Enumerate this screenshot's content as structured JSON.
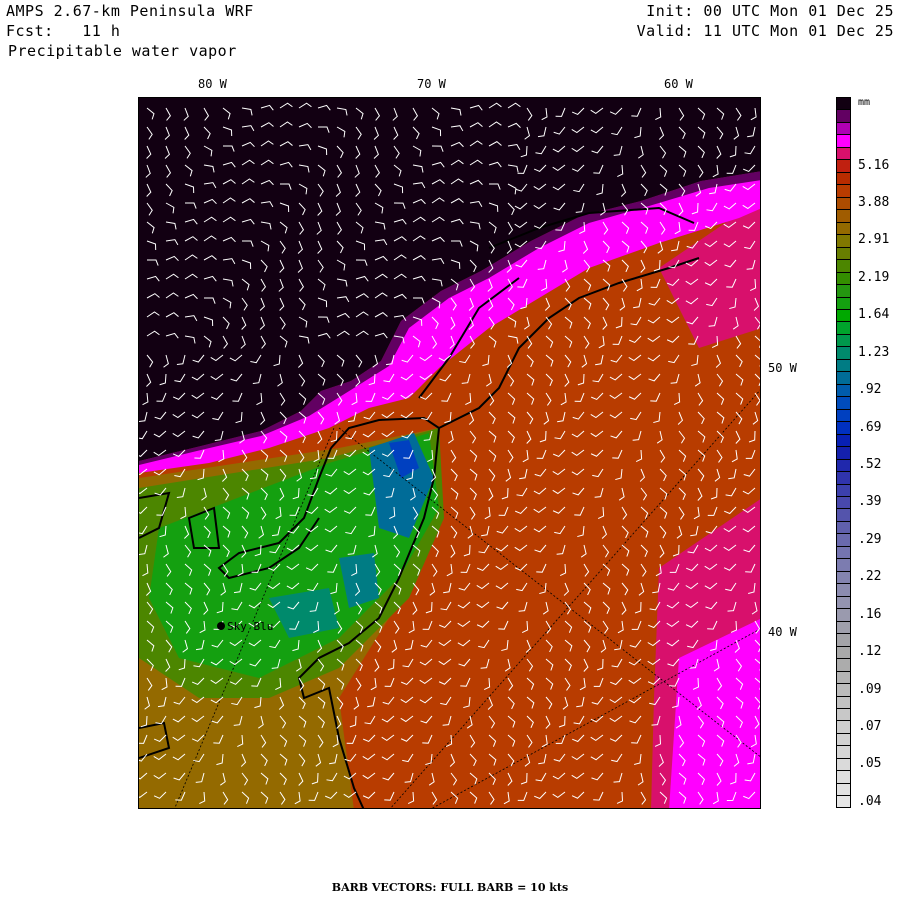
{
  "header": {
    "title": "AMPS 2.67-km Peninsula WRF",
    "forecast": "Fcst:   11 h",
    "field": "Precipitable water vapor",
    "init": "Init: 00 UTC Mon 01 Dec 25",
    "valid": "Valid: 11 UTC Mon 01 Dec 25"
  },
  "map": {
    "lon_labels": [
      "80 W",
      "70 W",
      "60 W"
    ],
    "side_labels": [
      "50 W",
      "40 W"
    ],
    "station": "Sky Blu"
  },
  "colorbar": {
    "unit": "mm",
    "labels": [
      "5.16",
      "3.88",
      "2.91",
      "2.19",
      "1.64",
      "1.23",
      ".92",
      ".69",
      ".52",
      ".39",
      ".29",
      ".22",
      ".16",
      ".12",
      ".09",
      ".07",
      ".05",
      ".04"
    ],
    "colors": [
      "#120012",
      "#620062",
      "#b000b4",
      "#ff00ff",
      "#d8106c",
      "#c02010",
      "#b82c00",
      "#b83c00",
      "#ac4c00",
      "#a05c00",
      "#946a00",
      "#807800",
      "#687e00",
      "#4c8600",
      "#348e00",
      "#249610",
      "#14a010",
      "#00a800",
      "#00a42c",
      "#00984c",
      "#008a6c",
      "#007c84",
      "#006c98",
      "#005cac",
      "#004cbc",
      "#0040c0",
      "#0030c0",
      "#0820b4",
      "#1420ac",
      "#2028ac",
      "#3034ac",
      "#3c40ac",
      "#4848ac",
      "#5454ac",
      "#6060ac",
      "#6a6aae",
      "#7474b0",
      "#7c7cb0",
      "#8484b0",
      "#8c8cb0",
      "#9494b0",
      "#9a9aae",
      "#a0a0ac",
      "#a4a4a8",
      "#a8a8a8",
      "#acacac",
      "#b4b4b4",
      "#bcbcbc",
      "#c2c2c2",
      "#c8c8c8",
      "#cecece",
      "#d2d2d2",
      "#d6d6d6",
      "#dadada",
      "#dedede",
      "#e2e2e2",
      "#e6e6e6"
    ]
  },
  "footer": "BARB VECTORS:  FULL BARB = 10 kts"
}
